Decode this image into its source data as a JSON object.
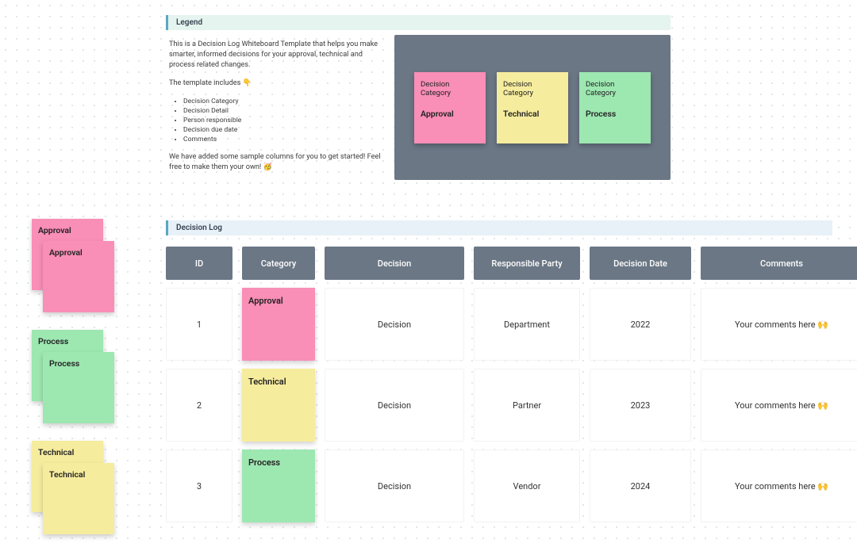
{
  "legend": {
    "title": "Legend",
    "intro": "This is a Decision Log Whiteboard Template that helps you make smarter, informed decisions for your approval, technical and process related changes.",
    "includes_label": "The template includes 👇",
    "bullets": [
      "Decision Category",
      "Decision Detail",
      "Person responsible",
      "Decision due date",
      "Comments"
    ],
    "outro": "We have added some sample columns for you to get started! Feel free to make them your own! 🥳",
    "category_label": "Decision Category",
    "types": {
      "approval": "Approval",
      "technical": "Technical",
      "process": "Process"
    }
  },
  "sidebar": {
    "approval": "Approval",
    "process": "Process",
    "technical": "Technical"
  },
  "log": {
    "title": "Decision Log",
    "headers": {
      "id": "ID",
      "category": "Category",
      "decision": "Decision",
      "responsible": "Responsible Party",
      "date": "Decision Date",
      "comments": "Comments"
    },
    "rows": [
      {
        "id": "1",
        "category_type": "approval",
        "category_label": "Approval",
        "decision": "Decision",
        "responsible": "Department",
        "date": "2022",
        "comments": "Your comments here 🙌"
      },
      {
        "id": "2",
        "category_type": "technical",
        "category_label": "Technical",
        "decision": "Decision",
        "responsible": "Partner",
        "date": "2023",
        "comments": "Your comments here 🙌"
      },
      {
        "id": "3",
        "category_type": "process",
        "category_label": "Process",
        "decision": "Decision",
        "responsible": "Vendor",
        "date": "2024",
        "comments": "Your comments here 🙌"
      }
    ]
  },
  "colors": {
    "pink": "#f98eb6",
    "yellow": "#f6ec9e",
    "green": "#9de7b1"
  }
}
